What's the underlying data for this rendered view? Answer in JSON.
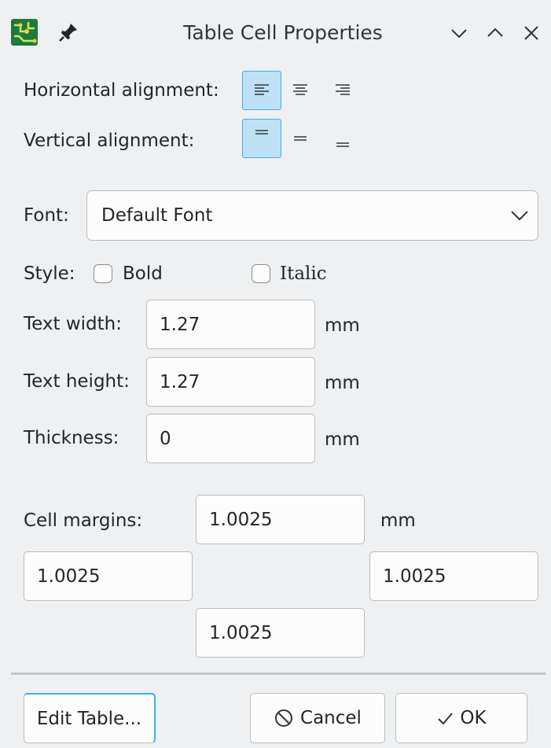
{
  "window": {
    "title": "Table Cell Properties"
  },
  "icons": {
    "app": "pcb-app-icon",
    "pin": "pin-icon",
    "minimize": "chevron-down-icon",
    "maximize": "chevron-up-icon",
    "close": "close-icon"
  },
  "alignment": {
    "horizontal_label": "Horizontal alignment:",
    "vertical_label": "Vertical alignment:",
    "horizontal_selected": "left",
    "vertical_selected": "top"
  },
  "font": {
    "label": "Font:",
    "value": "Default Font"
  },
  "style": {
    "label": "Style:",
    "bold": "Bold",
    "italic": "Italic",
    "bold_checked": false,
    "italic_checked": false
  },
  "text_width": {
    "label": "Text width:",
    "value": "1.27",
    "unit": "mm"
  },
  "text_height": {
    "label": "Text height:",
    "value": "1.27",
    "unit": "mm"
  },
  "thickness": {
    "label": "Thickness:",
    "value": "0",
    "unit": "mm"
  },
  "margins": {
    "label": "Cell margins:",
    "unit": "mm",
    "top": "1.0025",
    "left": "1.0025",
    "right": "1.0025",
    "bottom": "1.0025"
  },
  "buttons": {
    "edit_table": "Edit Table...",
    "cancel": "Cancel",
    "ok": "OK"
  },
  "colors": {
    "accent": "#3daee9",
    "selected_bg": "#bfe1f6",
    "window_bg": "#eff0f1"
  }
}
